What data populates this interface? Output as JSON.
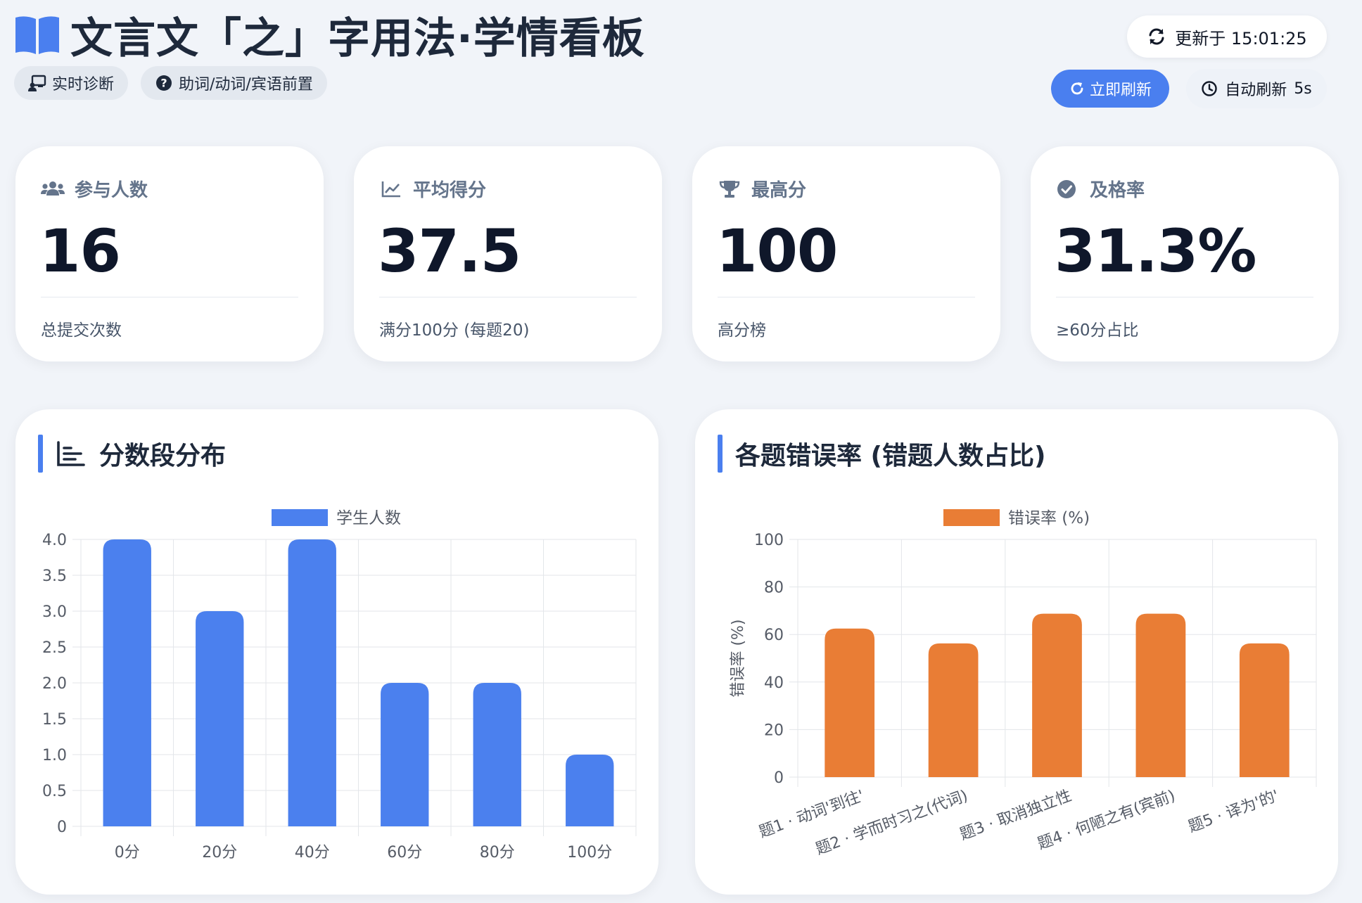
{
  "header": {
    "title": "文言文「之」字用法·学情看板",
    "tags": [
      {
        "label": "实时诊断",
        "icon": "teacher-board-icon"
      },
      {
        "label": "助词/动词/宾语前置",
        "icon": "question-circle-icon"
      }
    ],
    "updated_label": "更新于 15:01:25",
    "refresh_button": "立即刷新",
    "auto_refresh_label": "自动刷新",
    "auto_refresh_interval": "5s"
  },
  "stats": [
    {
      "label": "参与人数",
      "value": "16",
      "foot": "总提交次数",
      "icon": "users-icon"
    },
    {
      "label": "平均得分",
      "value": "37.5",
      "foot": "满分100分 (每题20)",
      "icon": "line-chart-icon"
    },
    {
      "label": "最高分",
      "value": "100",
      "foot": "高分榜",
      "icon": "trophy-icon"
    },
    {
      "label": "及格率",
      "value": "31.3%",
      "foot": "≥60分占比",
      "icon": "check-circle-icon"
    }
  ],
  "charts": {
    "score_title": "分数段分布",
    "error_title": "各题错误率 (错题人数占比)"
  },
  "colors": {
    "accent": "#4a7fef",
    "bar_blue": "#4b80ee",
    "bar_orange": "#e97d35"
  },
  "chart_data": [
    {
      "type": "bar",
      "categories": [
        "0分",
        "20分",
        "40分",
        "60分",
        "80分",
        "100分"
      ],
      "series": [
        {
          "name": "学生人数",
          "values": [
            4,
            3,
            4,
            2,
            2,
            1
          ]
        }
      ],
      "ylim": [
        0,
        4
      ],
      "yticks": [
        "0",
        "0.5",
        "1.0",
        "1.5",
        "2.0",
        "2.5",
        "3.0",
        "3.5",
        "4.0"
      ],
      "xlabel": "",
      "ylabel": "",
      "legend": "top-center",
      "grid": true
    },
    {
      "type": "bar",
      "categories": [
        "题1 · 动词'到往'",
        "题2 · 学而时习之(代词)",
        "题3 · 取消独立性",
        "题4 · 何陋之有(宾前)",
        "题5 · 译为'的'"
      ],
      "series": [
        {
          "name": "错误率 (%)",
          "values": [
            62.5,
            56.25,
            68.75,
            68.75,
            56.25
          ]
        }
      ],
      "ylim": [
        0,
        100
      ],
      "yticks": [
        "0",
        "20",
        "40",
        "60",
        "80",
        "100"
      ],
      "xlabel": "",
      "ylabel": "错误率 (%)",
      "legend": "top-center",
      "grid": true
    }
  ]
}
